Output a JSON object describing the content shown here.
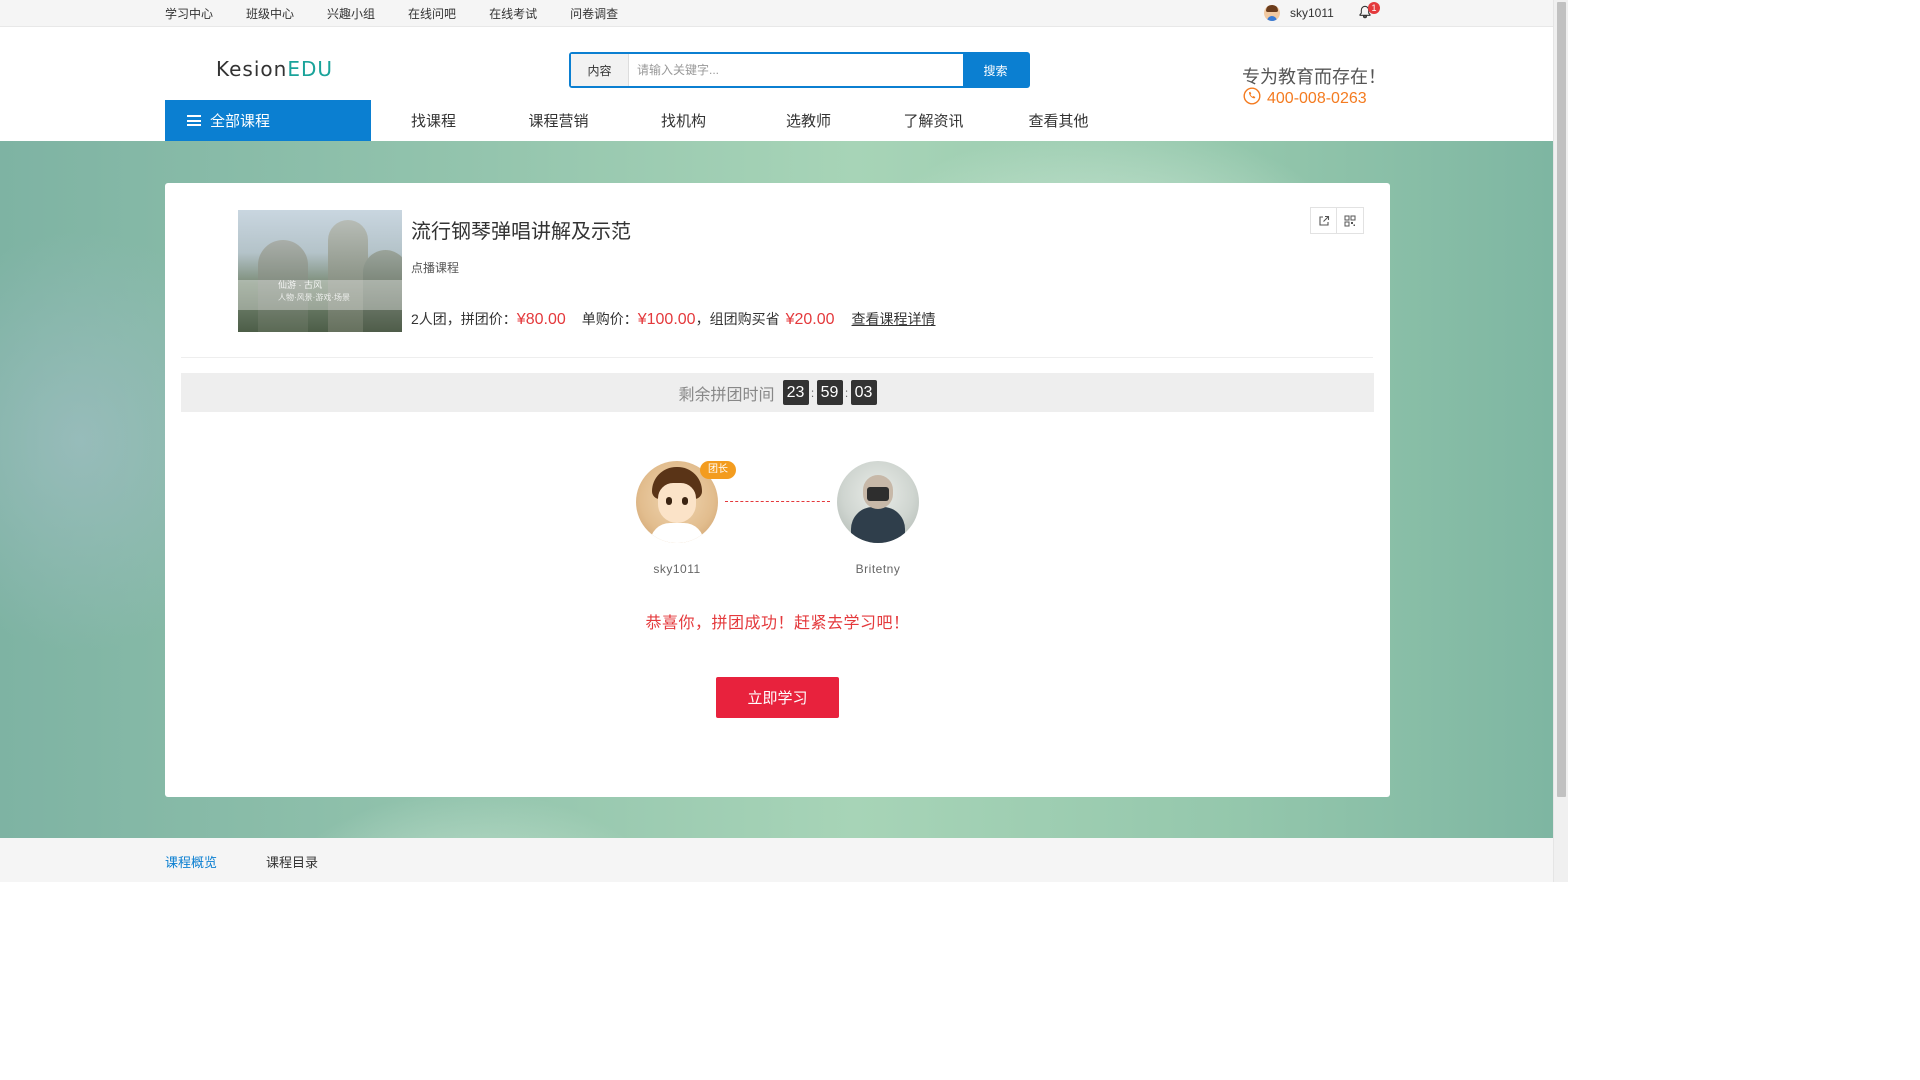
{
  "topbar": {
    "links": [
      "学习中心",
      "班级中心",
      "兴趣小组",
      "在线问吧",
      "在线考试",
      "问卷调查"
    ],
    "username": "sky1011",
    "notification_count": "1"
  },
  "header": {
    "logo_part1": "Kesion",
    "logo_part2": "EDU",
    "search_category": "内容",
    "search_placeholder": "请输入关键字...",
    "search_button": "搜索",
    "slogan": "专为教育而存在！",
    "phone": "400-008-0263",
    "all_courses": "全部课程",
    "nav": [
      "找课程",
      "课程营销",
      "找机构",
      "选教师",
      "了解资讯",
      "查看其他"
    ]
  },
  "course": {
    "title": "流行钢琴弹唱讲解及示范",
    "type": "点播课程",
    "thumb_caption1": "仙游 · 古风",
    "thumb_caption2": "人物·风景·游戏·场景",
    "group_text": "2人团，拼团价：",
    "group_price": "¥80.00",
    "single_text": "单购价：",
    "single_price": "¥100.00",
    "save_text": "，组团购买省",
    "save_price": "¥20.00",
    "detail_link": "查看课程详情"
  },
  "timer": {
    "label": "剩余拼团时间",
    "hours": "23",
    "minutes": "59",
    "seconds": "03"
  },
  "group": {
    "leader_badge": "团长",
    "members": [
      "sky1011",
      "Britetny"
    ],
    "success_msg": "恭喜你，拼团成功！赶紧去学习吧！",
    "study_button": "立即学习"
  },
  "tabs": [
    "课程概览",
    "课程目录"
  ],
  "colors": {
    "brand_blue": "#0b7fd1",
    "price_red": "#e4393c",
    "phone_orange": "#f47b20",
    "logo_teal": "#1aa39a"
  }
}
